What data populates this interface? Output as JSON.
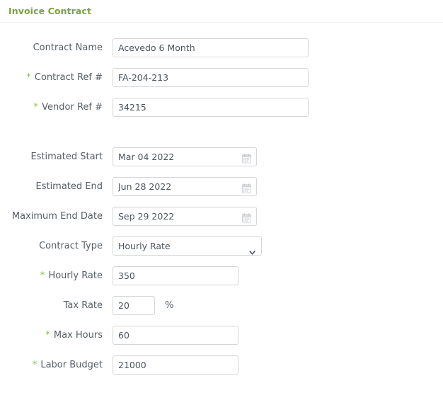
{
  "header": {
    "title": "Invoice Contract",
    "title_color": "#7ba23f"
  },
  "theme": {
    "required_marker": "*",
    "required_color": "#8cc152",
    "label_color": "#555e66",
    "input_border": "#d4d6d9",
    "background": "#ffffff"
  },
  "form": {
    "contract_name": {
      "label": "Contract Name",
      "value": "Acevedo 6 Month",
      "placeholder": "",
      "required": false
    },
    "contract_ref": {
      "label": "Contract Ref #",
      "value": "FA-204-213",
      "placeholder": "",
      "required": true
    },
    "vendor_ref": {
      "label": "Vendor Ref #",
      "value": "34215",
      "placeholder": "",
      "required": true
    },
    "estimated_start": {
      "label": "Estimated Start",
      "value": "Mar 04 2022",
      "placeholder": "",
      "icon": "calendar-icon",
      "required": false
    },
    "estimated_end": {
      "label": "Estimated End",
      "value": "Jun 28 2022",
      "placeholder": "",
      "icon": "calendar-icon",
      "required": false
    },
    "maximum_end_date": {
      "label": "Maximum End Date",
      "value": "Sep 29 2022",
      "placeholder": "",
      "icon": "calendar-icon",
      "required": false
    },
    "contract_type": {
      "label": "Contract Type",
      "value": "Hourly Rate",
      "options": [
        "Hourly Rate"
      ],
      "icon": "chevron-down-icon",
      "required": false
    },
    "hourly_rate": {
      "label": "Hourly Rate",
      "value": "350",
      "placeholder": "",
      "required": true
    },
    "tax_rate": {
      "label": "Tax Rate",
      "value": "20",
      "placeholder": "",
      "suffix": "%",
      "required": false
    },
    "max_hours": {
      "label": "Max Hours",
      "value": "60",
      "placeholder": "",
      "required": true
    },
    "labor_budget": {
      "label": "Labor Budget",
      "value": "21000",
      "placeholder": "",
      "required": true
    }
  }
}
